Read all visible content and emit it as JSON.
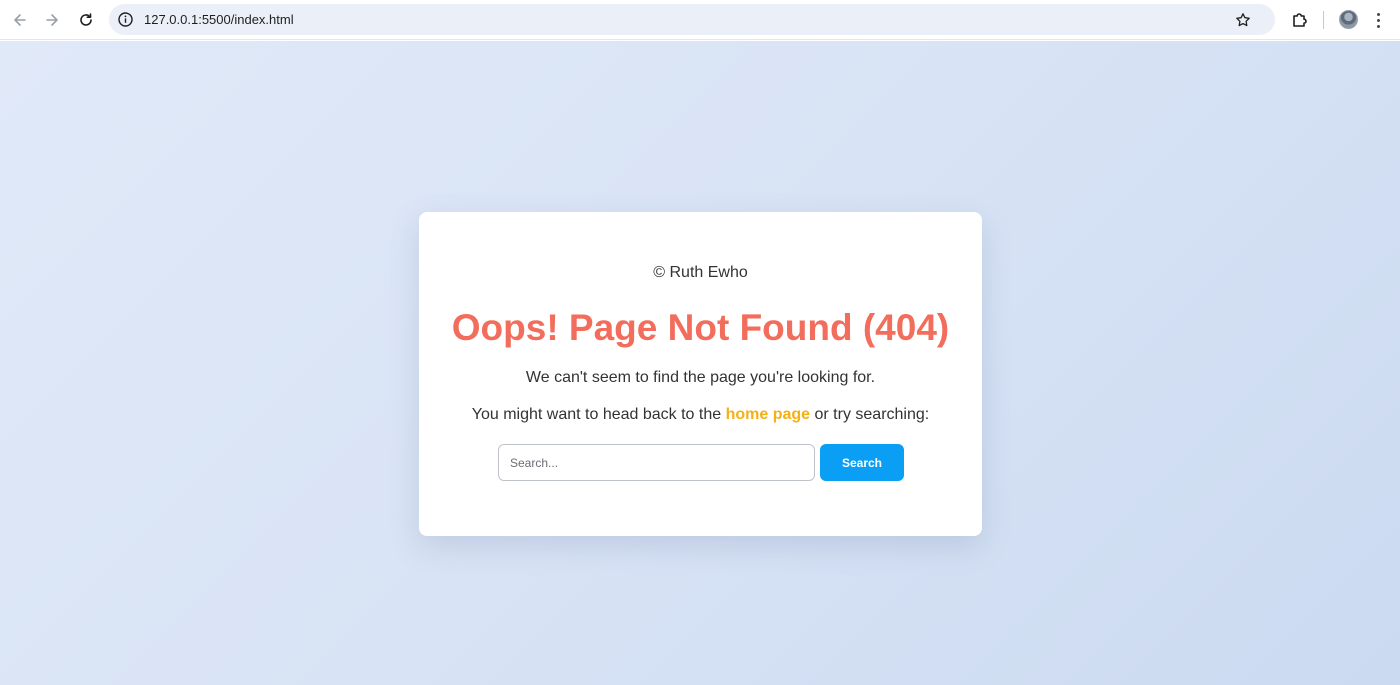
{
  "browser": {
    "url": "127.0.0.1:5500/index.html",
    "icons": {
      "back": "arrow-left-icon",
      "forward": "arrow-right-icon",
      "reload": "reload-icon",
      "site_info": "info-icon",
      "bookmark": "star-icon",
      "extensions": "puzzle-icon",
      "profile": "avatar",
      "menu": "kebab-menu-icon"
    }
  },
  "page": {
    "copyright": "© Ruth Ewho",
    "title": "Oops! Page Not Found (404)",
    "message": "We can't seem to find the page you're looking for.",
    "suggestion_prefix": "You might want to head back to the",
    "home_link_label": "home page",
    "suggestion_suffix": "or try searching:",
    "search": {
      "placeholder": "Search...",
      "value": "",
      "button_label": "Search"
    }
  },
  "colors": {
    "background_gradient_start": "#e0e9f8",
    "background_gradient_end": "#cbdaf1",
    "title": "#f26d5b",
    "link": "#f5b014",
    "search_button": "#0a9ef5",
    "card": "#ffffff"
  }
}
